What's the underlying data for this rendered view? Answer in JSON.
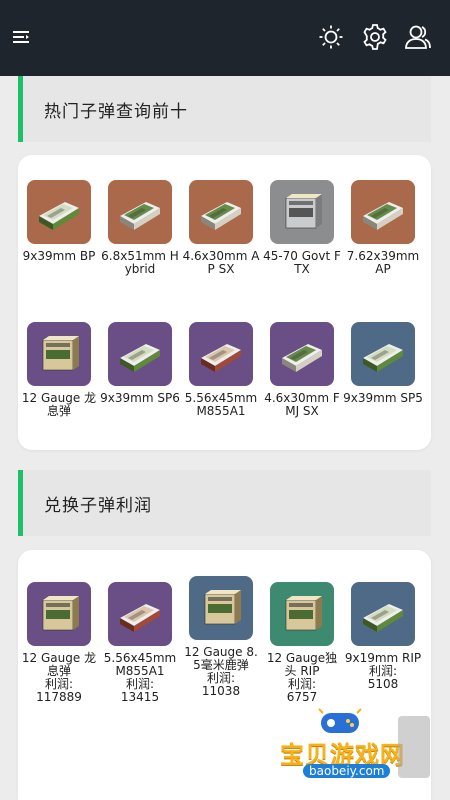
{
  "header": {
    "icons": [
      "menu-icon",
      "brightness-icon",
      "settings-icon",
      "user-icon"
    ]
  },
  "sections": [
    {
      "title": "热门子弹查询前十",
      "items": [
        {
          "label": "9x39mm BP",
          "color": "#a9694a",
          "box": "green"
        },
        {
          "label": "6.8x51mm Hybrid",
          "color": "#a9694a",
          "box": "white"
        },
        {
          "label": "4.6x30mm AP SX",
          "color": "#a9694a",
          "box": "white"
        },
        {
          "label": "45-70 Govt FTX",
          "color": "#8b8d8f",
          "box": "grey-pack"
        },
        {
          "label": "7.62x39mm AP",
          "color": "#a9694a",
          "box": "white"
        },
        {
          "label": "12 Gauge 龙息弹",
          "color": "#6a4f86",
          "box": "shells"
        },
        {
          "label": "9x39mm SP6",
          "color": "#6a4f86",
          "box": "green"
        },
        {
          "label": "5.56x45mm M855A1",
          "color": "#6a4f86",
          "box": "red"
        },
        {
          "label": "4.6x30mm FMJ SX",
          "color": "#6a4f86",
          "box": "white"
        },
        {
          "label": "9x39mm SP5",
          "color": "#4f6a86",
          "box": "green"
        }
      ]
    },
    {
      "title": "兑换子弹利润",
      "items": [
        {
          "label": "12 Gauge 龙息弹",
          "profit_label": "利润:",
          "profit": "117889",
          "color": "#6a4f86",
          "box": "shells"
        },
        {
          "label": "5.56x45mm M855A1",
          "profit_label": "利润:",
          "profit": "13415",
          "color": "#6a4f86",
          "box": "red"
        },
        {
          "label": "12 Gauge 8.5毫米鹿弹",
          "profit_label": "利润:",
          "profit": "11038",
          "color": "#4f6a86",
          "box": "shells"
        },
        {
          "label": "12 Gauge独头 RIP",
          "profit_label": "利润:",
          "profit": "6757",
          "color": "#3d8a71",
          "box": "shells"
        },
        {
          "label": "9x19mm RIP",
          "profit_label": "利润:",
          "profit": "5108",
          "color": "#4f6a86",
          "box": "green"
        }
      ]
    }
  ],
  "watermark": {
    "text": "宝贝游戏网",
    "domain": "baobeiy.com"
  }
}
